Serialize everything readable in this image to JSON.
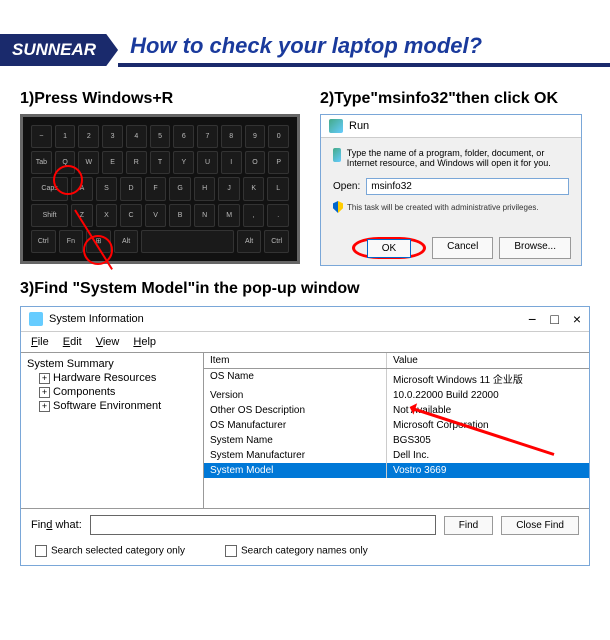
{
  "brand": "SUNNEAR",
  "title": "How to check your laptop model?",
  "step1": {
    "label": "1)Press Windows+R"
  },
  "step2": {
    "label": "2)Type\"msinfo32\"then click OK",
    "dialog_title": "Run",
    "help_text": "Type the name of a program, folder, document, or Internet resource, and Windows will open it for you.",
    "open_label": "Open:",
    "input_value": "msinfo32",
    "admin_text": "This task will be created with administrative privileges.",
    "ok": "OK",
    "cancel": "Cancel",
    "browse": "Browse..."
  },
  "step3": {
    "label": "3)Find \"System Model\"in the pop-up window",
    "window_title": "System Information",
    "menu": {
      "file": "File",
      "edit": "Edit",
      "view": "View",
      "help": "Help"
    },
    "tree": {
      "root": "System Summary",
      "items": [
        "Hardware Resources",
        "Components",
        "Software Environment"
      ]
    },
    "headers": {
      "item": "Item",
      "value": "Value"
    },
    "rows": [
      {
        "item": "OS Name",
        "value": "Microsoft Windows 11 企业版"
      },
      {
        "item": "Version",
        "value": "10.0.22000 Build 22000"
      },
      {
        "item": "Other OS Description",
        "value": "Not Available"
      },
      {
        "item": "OS Manufacturer",
        "value": "Microsoft Corporation"
      },
      {
        "item": "System Name",
        "value": "BGS305"
      },
      {
        "item": "System Manufacturer",
        "value": "Dell Inc."
      },
      {
        "item": "System Model",
        "value": "Vostro 3669",
        "selected": true
      }
    ],
    "find_label": "Find what:",
    "find_btn": "Find",
    "close_btn": "Close Find",
    "check1": "Search selected category only",
    "check2": "Search category names only"
  }
}
